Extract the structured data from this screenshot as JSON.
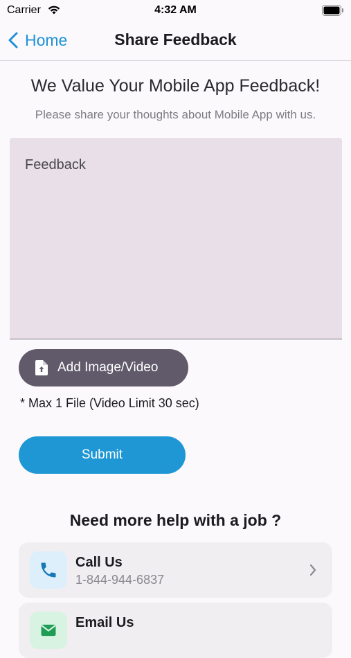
{
  "status_bar": {
    "carrier": "Carrier",
    "time": "4:32 AM"
  },
  "nav": {
    "back_label": "Home",
    "title": "Share Feedback"
  },
  "page": {
    "headline": "We Value Your Mobile App Feedback!",
    "subheadline": "Please share your thoughts about Mobile App with us.",
    "feedback_placeholder": "Feedback",
    "add_media_label": "Add Image/Video",
    "file_note": "* Max 1 File (Video Limit 30 sec)",
    "submit_label": "Submit"
  },
  "help": {
    "heading": "Need more help with a job ?",
    "contacts": [
      {
        "title": "Call Us",
        "subtitle": "1-844-944-6837",
        "icon": "phone-icon"
      },
      {
        "title": "Email Us",
        "subtitle": "",
        "icon": "mail-icon"
      }
    ]
  },
  "colors": {
    "accent": "#1e97d4",
    "secondary_button": "#605a6b",
    "input_bg": "#e8dfe8"
  }
}
